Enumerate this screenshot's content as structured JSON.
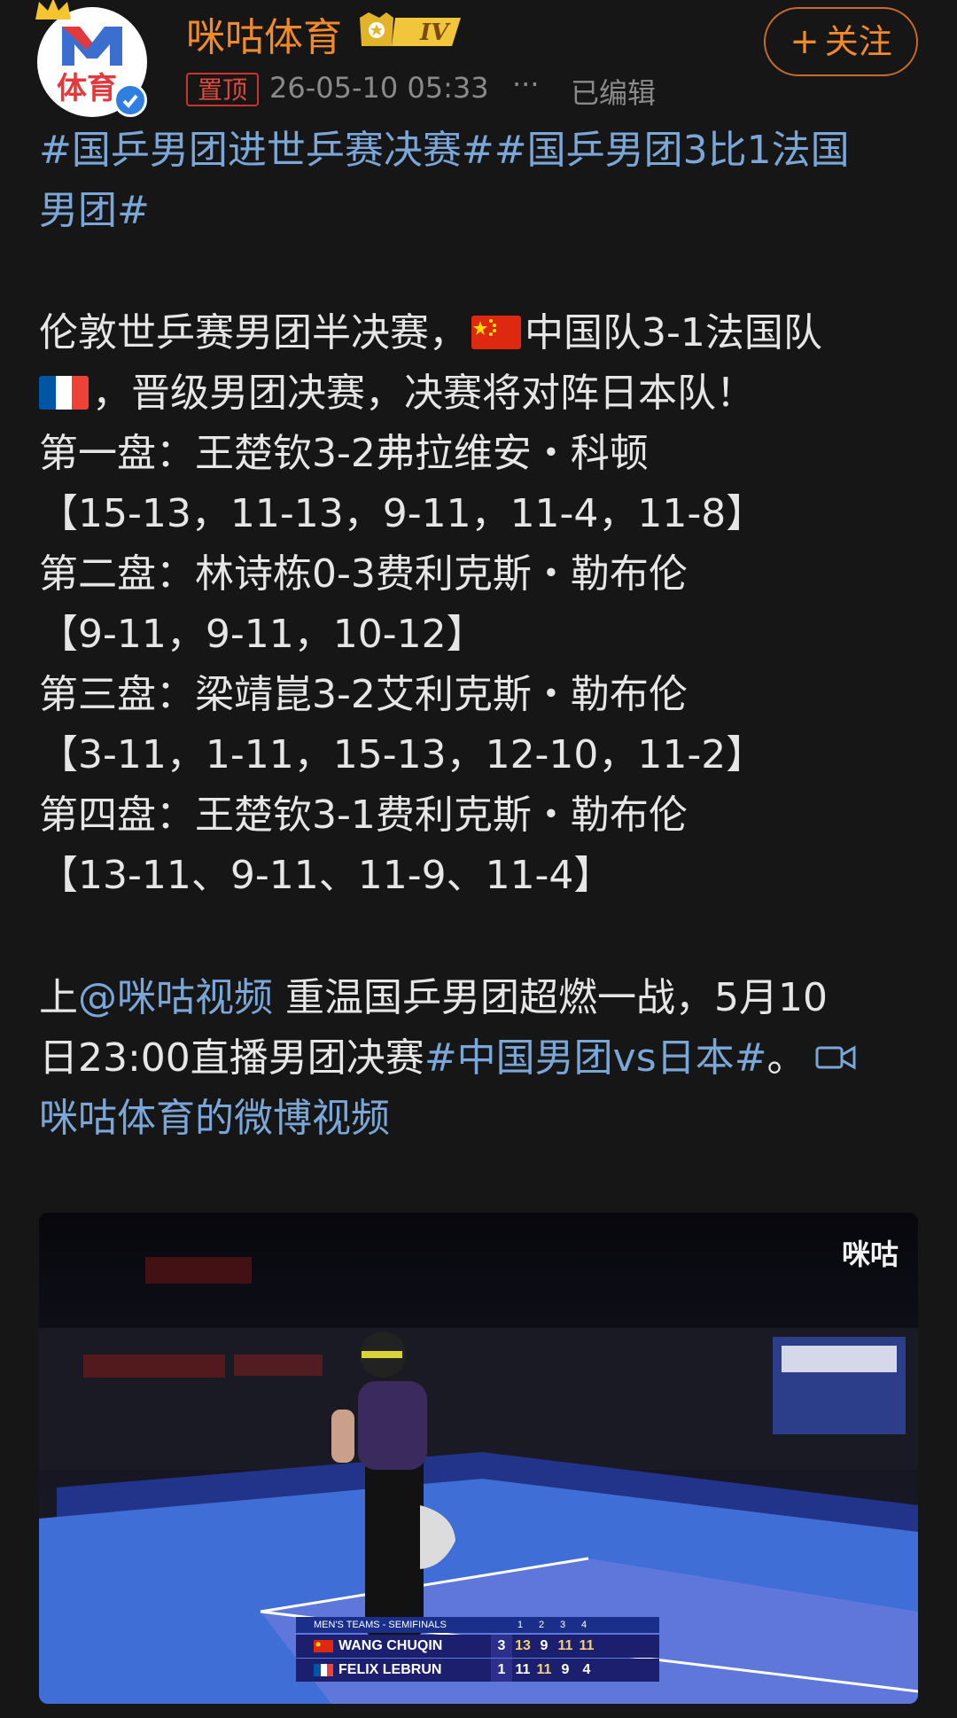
{
  "header": {
    "avatar_text": "体育",
    "username": "咪咕体育",
    "level": "IV",
    "pinned": "置顶",
    "time": "26-05-10 05:33",
    "more": "···",
    "edited": "已编辑",
    "follow_label": "关注",
    "follow_plus": "+"
  },
  "post": {
    "tags_line1": "#国乒男团进世乒赛决赛##国乒男团3比1法国",
    "tags_line2": "男团#",
    "l1a": "伦敦世乒赛男团半决赛，",
    "l1b": "中国队3-1法国队",
    "l2": "，晋级男团决赛，决赛将对阵日本队！",
    "g1": "第一盘：王楚钦3-2弗拉维安・科顿",
    "g1s": "【15-13，11-13，9-11，11-4，11-8】",
    "g2": "第二盘：林诗栋0-3费利克斯・勒布伦",
    "g2s": "【9-11，9-11，10-12】",
    "g3": "第三盘：梁靖崑3-2艾利克斯・勒布伦",
    "g3s": "【3-11，1-11，15-13，12-10，11-2】",
    "g4": "第四盘：王楚钦3-1费利克斯・勒布伦",
    "g4s": "【13-11、9-11、11-9、11-4】",
    "p2a": "上",
    "mention": "@咪咕视频",
    "p2b": " 重温国乒男团超燃一战，5月10",
    "p3a": "日23:00直播男团决赛",
    "p3tag": "#中国男团vs日本#",
    "p3b": "。",
    "video_link": "咪咕体育的微博视频"
  },
  "video": {
    "watermark": "咪咕",
    "scoreboard": {
      "title": "MEN'S TEAMS - SEMIFINALS",
      "cols": [
        "1",
        "2",
        "3",
        "4"
      ],
      "rows": [
        {
          "name": "WANG CHUQIN",
          "games": "3",
          "scores": [
            "13",
            "9",
            "11",
            "11"
          ]
        },
        {
          "name": "FELIX LEBRUN",
          "games": "1",
          "scores": [
            "11",
            "11",
            "9",
            "4"
          ]
        }
      ]
    }
  },
  "colors": {
    "accent": "#f08a2b",
    "link": "#7aa7d8",
    "background": "#161616"
  }
}
